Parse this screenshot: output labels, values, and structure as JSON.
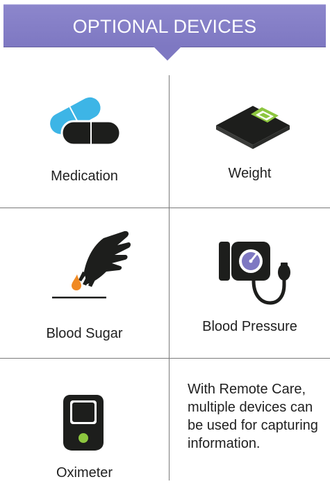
{
  "header": {
    "title": "OPTIONAL DEVICES"
  },
  "colors": {
    "banner": "#7e78c2",
    "pill_blue": "#3db5e6",
    "dark": "#1d1e1c",
    "screen_green": "#8dc63f",
    "drop_orange": "#f08a24"
  },
  "devices": {
    "medication": {
      "label": "Medication",
      "icon": "pill-capsule-icon"
    },
    "weight": {
      "label": "Weight",
      "icon": "scale-icon"
    },
    "blood_sugar": {
      "label": "Blood Sugar",
      "icon": "hand-blood-drop-icon"
    },
    "blood_pressure": {
      "label": "Blood Pressure",
      "icon": "blood-pressure-cuff-icon"
    },
    "oximeter": {
      "label": "Oximeter",
      "icon": "oximeter-icon"
    }
  },
  "info": {
    "lines": [
      "With Remote Care,",
      "multiple devices can",
      "be used for capturing",
      "information."
    ]
  }
}
